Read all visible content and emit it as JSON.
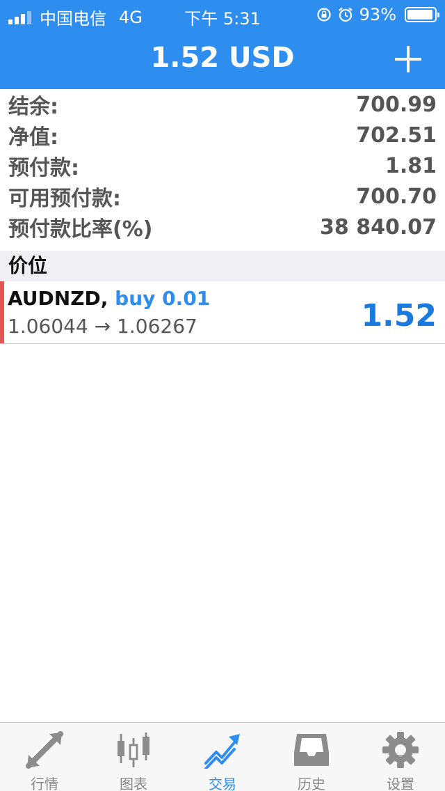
{
  "status_bar": {
    "carrier": "中国电信",
    "network": "4G",
    "time": "下午 5:31",
    "battery": "93%"
  },
  "nav": {
    "title": "1.52 USD"
  },
  "summary": [
    {
      "label": "结余:",
      "value": "700.99"
    },
    {
      "label": "净值:",
      "value": "702.51"
    },
    {
      "label": "预付款:",
      "value": "1.81"
    },
    {
      "label": "可用预付款:",
      "value": "700.70"
    },
    {
      "label": "预付款比率(%)",
      "value": "38 840.07"
    }
  ],
  "section": {
    "title": "价位"
  },
  "position": {
    "symbol": "AUDNZD,",
    "type": "buy 0.01",
    "prices": "1.06044 → 1.06267",
    "profit": "1.52"
  },
  "tabs": [
    {
      "label": "行情",
      "icon": "quotes-arrows-icon"
    },
    {
      "label": "图表",
      "icon": "candlestick-chart-icon"
    },
    {
      "label": "交易",
      "icon": "trade-trend-icon"
    },
    {
      "label": "历史",
      "icon": "history-inbox-icon"
    },
    {
      "label": "设置",
      "icon": "gear-icon"
    }
  ],
  "colors": {
    "header": "#2e8ef0",
    "accent": "#2e8ef0",
    "profit": "#1a7ae0",
    "position_marker": "#e25555",
    "tab_inactive": "#888888"
  }
}
